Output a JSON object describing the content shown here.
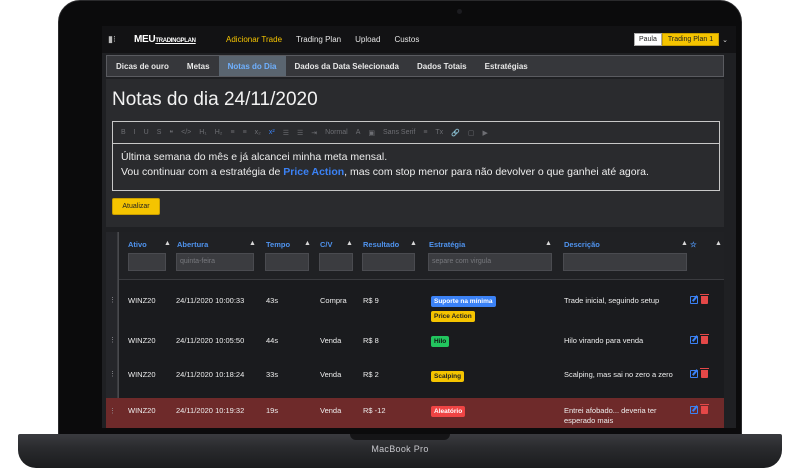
{
  "device": {
    "label": "MacBook Pro"
  },
  "navbar": {
    "logo_main": "MEU",
    "logo_small": "TRADINGPLAN",
    "links": [
      "Adicionar Trade",
      "Trading Plan",
      "Upload",
      "Custos"
    ],
    "active_link": "Adicionar Trade",
    "user_name": "Paula",
    "plan_name": "Trading Plan 1"
  },
  "tabs": [
    "Dicas de ouro",
    "Metas",
    "Notas do Dia",
    "Dados da Data Selecionada",
    "Dados Totais",
    "Estratégias"
  ],
  "active_tab": "Notas do Dia",
  "notes": {
    "title": "Notas do dia 24/11/2020",
    "toolbar": [
      "B",
      "I",
      "U",
      "S",
      "❝",
      "</>",
      "H₁",
      "H₂",
      "≡",
      "≡",
      "x₂",
      "x²",
      "☰",
      "☰",
      "⇥",
      "Normal",
      "A",
      "▣",
      "Sans Serif",
      "≡",
      "Tx",
      "🔗",
      "▢",
      "▶"
    ],
    "line1": "Última semana do mês e já alcancei minha meta mensal.",
    "line2_before": "Vou continuar com a estratégia de ",
    "line2_highlight": "Price Action",
    "line2_after": ", mas com stop menor para não devolver o que ganhei até agora.",
    "update_button": "Atualizar"
  },
  "table": {
    "columns": [
      "Ativo",
      "Abertura",
      "Tempo",
      "C/V",
      "Resultado",
      "Estratégia",
      "Descrição",
      "☆"
    ],
    "filters": {
      "abertura": "quinta-feira",
      "estrategia": "separe com virgula"
    },
    "rows": [
      {
        "ativo": "WINZ20",
        "abertura": "24/11/2020 10:00:33",
        "tempo": "43s",
        "cv": "Compra",
        "resultado": "R$ 9",
        "estrategias": [
          {
            "label": "Suporte na mínima",
            "color": "blue"
          },
          {
            "label": "Price Action",
            "color": "yellow"
          }
        ],
        "descricao": "Trade inicial, seguindo setup",
        "loss": false
      },
      {
        "ativo": "WINZ20",
        "abertura": "24/11/2020 10:05:50",
        "tempo": "44s",
        "cv": "Venda",
        "resultado": "R$ 8",
        "estrategias": [
          {
            "label": "Hilo",
            "color": "green"
          }
        ],
        "descricao": "Hilo virando para venda",
        "loss": false
      },
      {
        "ativo": "WINZ20",
        "abertura": "24/11/2020 10:18:24",
        "tempo": "33s",
        "cv": "Venda",
        "resultado": "R$ 2",
        "estrategias": [
          {
            "label": "Scalping",
            "color": "yellow"
          }
        ],
        "descricao": "Scalping, mas sai no zero a zero",
        "loss": false
      },
      {
        "ativo": "WINZ20",
        "abertura": "24/11/2020 10:19:32",
        "tempo": "19s",
        "cv": "Venda",
        "resultado": "R$ -12",
        "estrategias": [
          {
            "label": "Aleatório",
            "color": "red"
          }
        ],
        "descricao": "Entrei afobado... deveria ter esperado mais",
        "loss": true
      }
    ]
  },
  "colors": {
    "accent": "#f5c400",
    "link": "#4f93ee",
    "loss_row": "#6e2a2a"
  }
}
